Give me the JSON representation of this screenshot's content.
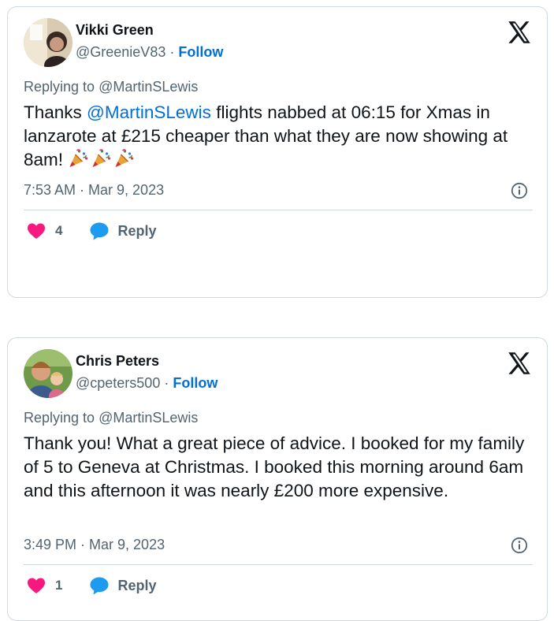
{
  "tweets": [
    {
      "author_name": "Vikki Green",
      "handle": "@GreenieV83",
      "separator": " · ",
      "follow_label": "Follow",
      "replying_prefix": "Replying to ",
      "replying_to": "@MartinSLewis",
      "text_before": "Thanks ",
      "mention": "@MartinSLewis",
      "text_after": " flights nabbed at 06:15 for Xmas in lanzarote at £215 cheaper than what they are now showing at 8am! ",
      "emoji": [
        "party-popper",
        "party-popper",
        "party-popper"
      ],
      "timestamp": "7:53 AM · Mar 9, 2023",
      "like_count": "4",
      "reply_label": "Reply"
    },
    {
      "author_name": "Chris Peters",
      "handle": "@cpeters500",
      "separator": " · ",
      "follow_label": "Follow",
      "replying_prefix": "Replying to ",
      "replying_to": "@MartinSLewis",
      "text": "Thank you! What a great piece of advice. I booked for my family of 5 to Geneva at Christmas. I booked this morning around 6am and this afternoon it was nearly £200 more expensive.",
      "timestamp": "3:49 PM · Mar 9, 2023",
      "like_count": "1",
      "reply_label": "Reply"
    }
  ],
  "colors": {
    "link": "#006fd6",
    "muted": "#536471",
    "text": "#0f1419",
    "heart": "#f91880",
    "reply_bubble": "#1d9bf0",
    "border": "#cfd9de"
  },
  "icons": [
    "avatar",
    "x-logo-icon",
    "info-icon",
    "heart-icon",
    "reply-bubble-icon",
    "party-popper-icon"
  ]
}
